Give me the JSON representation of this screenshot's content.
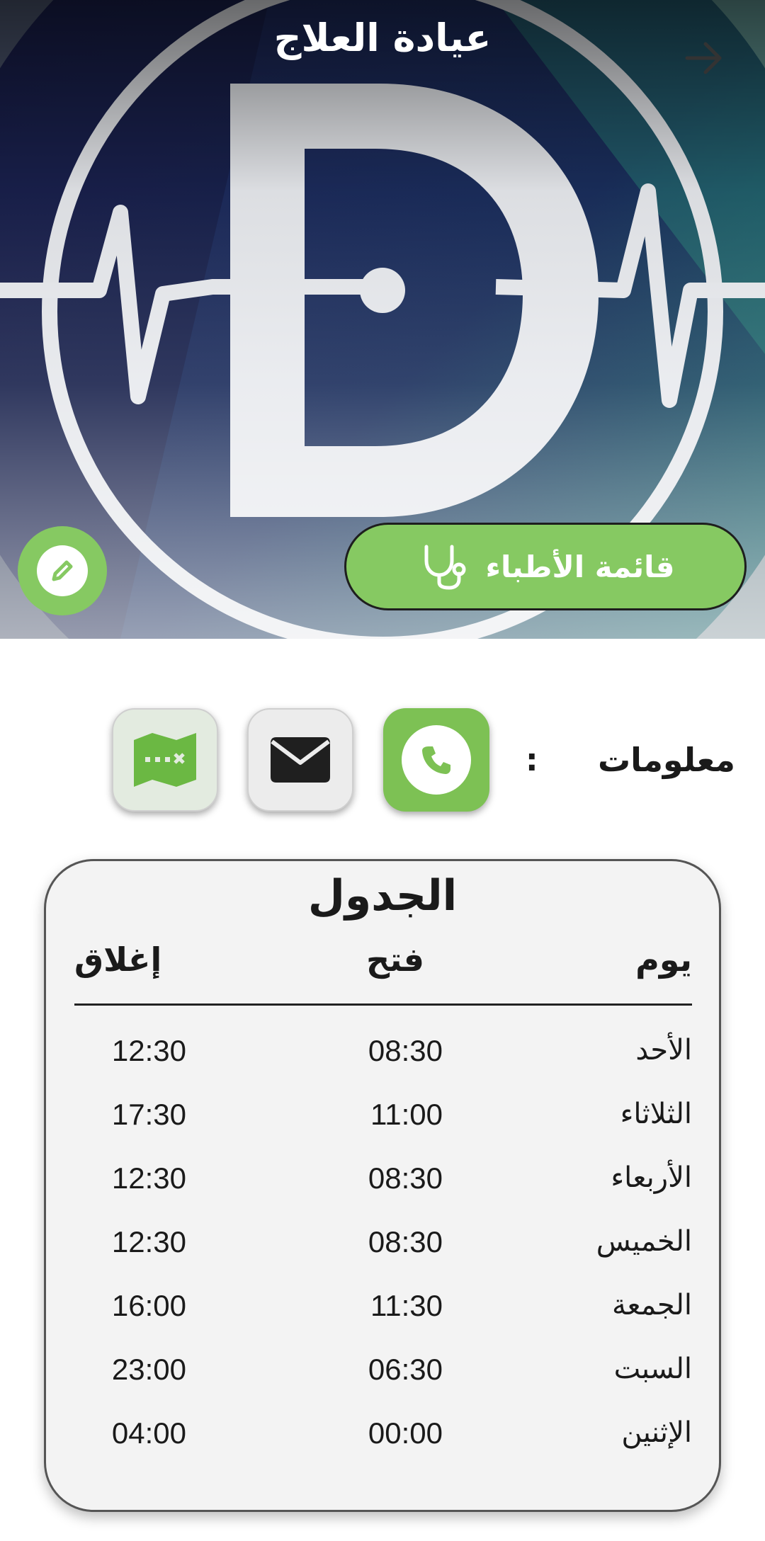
{
  "header": {
    "title": "عيادة العلاج"
  },
  "hero": {
    "doctors_button_label": "قائمة الأطباء"
  },
  "info": {
    "label": "معلومات",
    "colon": ":"
  },
  "schedule": {
    "title": "الجدول",
    "headers": {
      "day": "يوم",
      "open": "فتح",
      "close": "إغلاق"
    },
    "rows": [
      {
        "day": "الأحد",
        "open": "08:30",
        "close": "12:30"
      },
      {
        "day": "الثلاثاء",
        "open": "11:00",
        "close": "17:30"
      },
      {
        "day": "الأربعاء",
        "open": "08:30",
        "close": "12:30"
      },
      {
        "day": "الخميس",
        "open": "08:30",
        "close": "12:30"
      },
      {
        "day": "الجمعة",
        "open": "11:30",
        "close": "16:00"
      },
      {
        "day": "السبت",
        "open": "06:30",
        "close": "23:00"
      },
      {
        "day": "الإثنين",
        "open": "00:00",
        "close": "04:00"
      }
    ]
  },
  "colors": {
    "accent_green": "#86c962",
    "logo_navy": "#1b1f4a",
    "logo_teal": "#1f6b6a"
  },
  "icons": {
    "back": "arrow-right-icon",
    "doctors": "stethoscope-icon",
    "edit": "pencil-icon",
    "phone": "phone-icon",
    "mail": "mail-icon",
    "map": "map-icon"
  }
}
